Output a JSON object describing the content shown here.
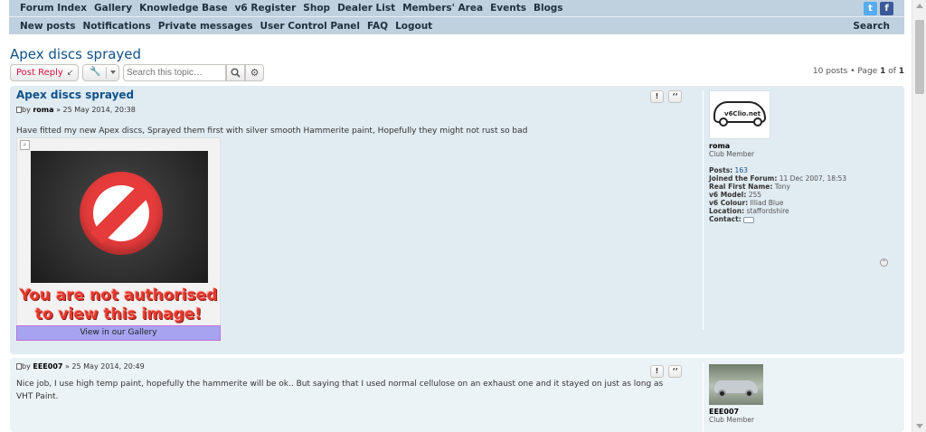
{
  "nav": {
    "row1": [
      "Forum Index",
      "Gallery",
      "Knowledge Base",
      "v6 Register",
      "Shop",
      "Dealer List",
      "Members' Area",
      "Events",
      "Blogs"
    ],
    "row2": [
      "New posts",
      "Notifications",
      "Private messages",
      "User Control Panel",
      "FAQ",
      "Logout"
    ],
    "search": "Search",
    "social": {
      "twitter": "t",
      "facebook": "f"
    }
  },
  "topic": {
    "title": "Apex discs sprayed",
    "reply_label": "Post Reply",
    "search_placeholder": "Search this topic…",
    "pagination": {
      "posts": "10 posts",
      "sep": " • Page ",
      "page": "1",
      "of": " of ",
      "total": "1"
    }
  },
  "posts": [
    {
      "title": "Apex discs sprayed",
      "by": "by ",
      "author": "roma",
      "date": " » 25 May 2014, 20:38",
      "text": "Have fitted my new Apex discs, Sprayed them first with silver smooth Hammerite paint, Hopefully they might not rust so bad",
      "blocked_image": {
        "warning": "You are not authorised to view this image!",
        "gallery_link": "View in our Gallery"
      },
      "profile": {
        "username": "roma",
        "rank": "Club Member",
        "logo_text": "v6Clio.net",
        "fields": [
          {
            "label": "Posts:",
            "value": " 163"
          },
          {
            "label": "Joined the Forum:",
            "value": " 11 Dec 2007, 18:53"
          },
          {
            "label": "Real First Name:",
            "value": " Tony"
          },
          {
            "label": "v6 Model:",
            "value": " 255"
          },
          {
            "label": "v6 Colour:",
            "value": " Illiad Blue"
          },
          {
            "label": "Location:",
            "value": " staffordshire"
          },
          {
            "label": "Contact:",
            "value": " "
          }
        ]
      },
      "buttons": {
        "report": "!",
        "quote": "‘‘"
      }
    },
    {
      "by": "by ",
      "author": "EEE007",
      "date": " » 25 May 2014, 20:49",
      "text": "Nice job, I use high temp paint, hopefully the hammerite will be ok.. But saying that I used normal cellulose on an exhaust one and it stayed on just as long as VHT Paint.",
      "profile": {
        "username": "EEE007",
        "rank": "Club Member"
      },
      "buttons": {
        "report": "!",
        "quote": "‘‘"
      }
    }
  ]
}
